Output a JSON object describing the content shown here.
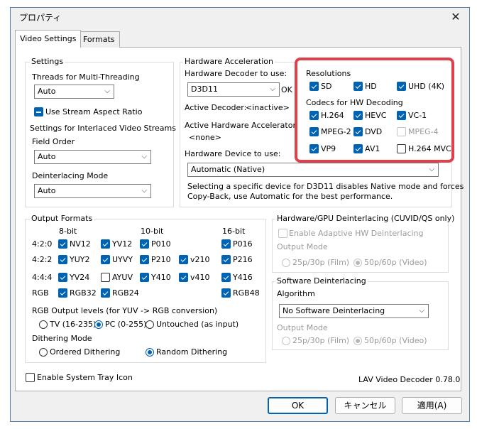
{
  "window": {
    "title": "プロパティ"
  },
  "tabs": [
    {
      "label": "Video Settings"
    },
    {
      "label": "Formats"
    }
  ],
  "settings": {
    "group_label": "Settings",
    "threads_label": "Threads for Multi-Threading",
    "threads_value": "Auto",
    "stream_aspect_label": "Use Stream Aspect Ratio",
    "interlaced_label": "Settings for Interlaced Video Streams",
    "field_order_label": "Field Order",
    "field_order_value": "Auto",
    "deint_mode_label": "Deinterlacing Mode",
    "deint_mode_value": "Auto"
  },
  "hwaccel": {
    "group_label": "Hardware Acceleration",
    "decoder_label": "Hardware Decoder to use:",
    "decoder_value": "D3D11",
    "decoder_status": "OK",
    "active_decoder_label": "Active Decoder:",
    "active_decoder_value": "<inactive>",
    "active_accel_label": "Active Hardware Accelerator:",
    "active_accel_value": "<none>",
    "device_label": "Hardware Device to use:",
    "device_value": "Automatic (Native)",
    "note_line1": "Selecting a specific device for D3D11 disables Native mode and forces",
    "note_line2": "Copy-Back, use Automatic for the best performance.",
    "resolutions_label": "Resolutions",
    "res_sd": "SD",
    "res_hd": "HD",
    "res_uhd": "UHD (4K)",
    "codecs_label": "Codecs for HW Decoding",
    "codec_h264": "H.264",
    "codec_hevc": "HEVC",
    "codec_vc1": "VC-1",
    "codec_mpeg2": "MPEG-2",
    "codec_dvd": "DVD",
    "codec_mpeg4": "MPEG-4",
    "codec_vp9": "VP9",
    "codec_av1": "AV1",
    "codec_h264mvc": "H.264 MVC"
  },
  "output_formats": {
    "group_label": "Output Formats",
    "col_8bit": "8-bit",
    "col_10bit": "10-bit",
    "col_16bit": "16-bit",
    "row_420": "4:2:0",
    "row_422": "4:2:2",
    "row_444": "4:4:4",
    "row_rgb": "RGB",
    "nv12": "NV12",
    "yv12": "YV12",
    "p010": "P010",
    "p016": "P016",
    "yuy2": "YUY2",
    "uyvy": "UYVY",
    "p210": "P210",
    "v210": "v210",
    "p216": "P216",
    "yv24": "YV24",
    "ayuv": "AYUV",
    "y410": "Y410",
    "v410": "v410",
    "y416": "Y416",
    "rgb32": "RGB32",
    "rgb24": "RGB24",
    "rgb48": "RGB48",
    "levels_label": "RGB Output levels (for YUV -> RGB conversion)",
    "level_tv": "TV (16-235)",
    "level_pc": "PC (0-255)",
    "level_untouched": "Untouched (as input)",
    "dither_label": "Dithering Mode",
    "dither_ordered": "Ordered Dithering",
    "dither_random": "Random Dithering"
  },
  "hw_deint": {
    "group_label": "Hardware/GPU Deinterlacing (CUVID/QS only)",
    "adaptive_label": "Enable Adaptive HW Deinterlacing",
    "output_mode_label": "Output Mode",
    "mode_film": "25p/30p (Film)",
    "mode_video": "50p/60p (Video)"
  },
  "sw_deint": {
    "group_label": "Software Deinterlacing",
    "algorithm_label": "Algorithm",
    "algorithm_value": "No Software Deinterlacing",
    "output_mode_label": "Output Mode",
    "mode_film": "25p/30p (Film)",
    "mode_video": "50p/60p (Video)"
  },
  "tray_label": "Enable System Tray Icon",
  "version": "LAV Video Decoder 0.78.0",
  "buttons": {
    "ok": "OK",
    "cancel": "キャンセル",
    "apply": "適用(A)"
  },
  "colors": {
    "accent": "#0063b1",
    "highlight": "#e0404a"
  },
  "icons": {
    "close": "close-icon",
    "chevron": "chevron-down-icon"
  }
}
